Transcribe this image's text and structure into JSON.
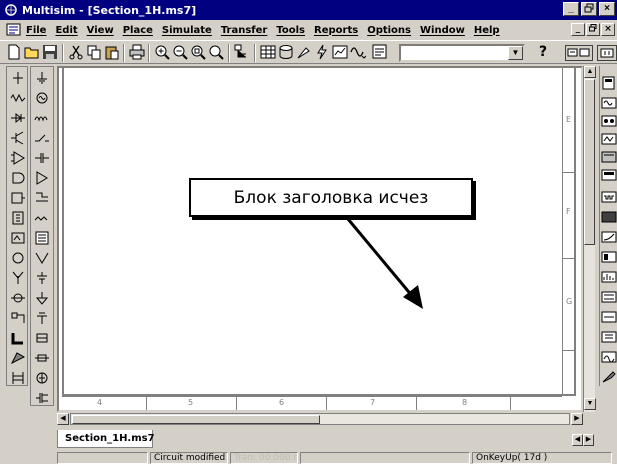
{
  "window": {
    "title": "Multisim - [Section_1H.ms7]",
    "controls": [
      "_",
      "×"
    ],
    "mdi_controls": [
      "_",
      "×"
    ]
  },
  "menu": [
    "File",
    "Edit",
    "View",
    "Place",
    "Simulate",
    "Transfer",
    "Tools",
    "Reports",
    "Options",
    "Window",
    "Help"
  ],
  "toolbar": {
    "help_label": "?",
    "combo_value": ""
  },
  "workspace": {
    "callout_text": "Блок заголовка исчез",
    "column_labels": [
      "4",
      "5",
      "6",
      "7",
      "8"
    ],
    "row_labels": [
      "E",
      "F",
      "G"
    ]
  },
  "tabs": {
    "active_label": "Section_1H.ms7"
  },
  "status": {
    "panel2": "Circuit modified",
    "panel3": "Tran: 00.000 ms",
    "panel5": "OnKeyUp( 17d )"
  },
  "colors": {
    "title_bg": "#000080",
    "chrome": "#d4d0c8",
    "workspace_bg": "#ffffff"
  }
}
